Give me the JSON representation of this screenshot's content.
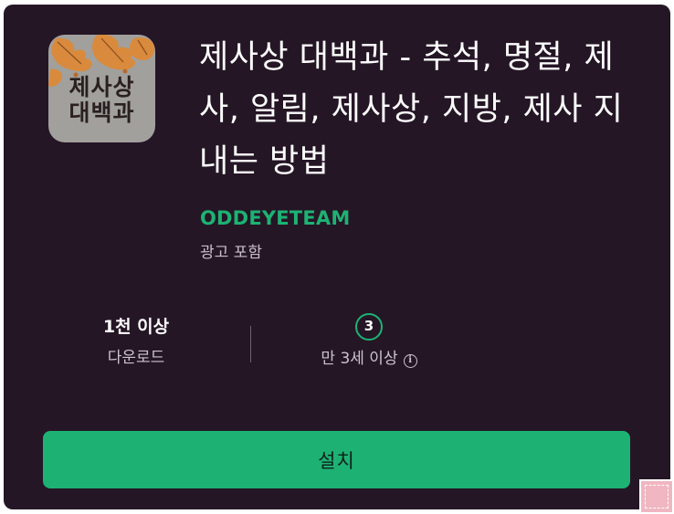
{
  "app": {
    "icon_text_line1": "제사상",
    "icon_text_line2": "대백과",
    "title": "제사상 대백과 - 추석, 명절, 제사, 알림, 제사상, 지방, 제사 지내는 방법",
    "developer": "ODDEYETEAM",
    "ads_note": "광고 포함"
  },
  "stats": {
    "downloads_value": "1천 이상",
    "downloads_label": "다운로드",
    "rating_value": "3",
    "rating_label": "만 3세 이상"
  },
  "install": {
    "label": "설치"
  },
  "colors": {
    "background": "#251626",
    "accent": "#1db273",
    "icon_background": "#a1a09d",
    "leaf_orange": "#d98a3d"
  }
}
